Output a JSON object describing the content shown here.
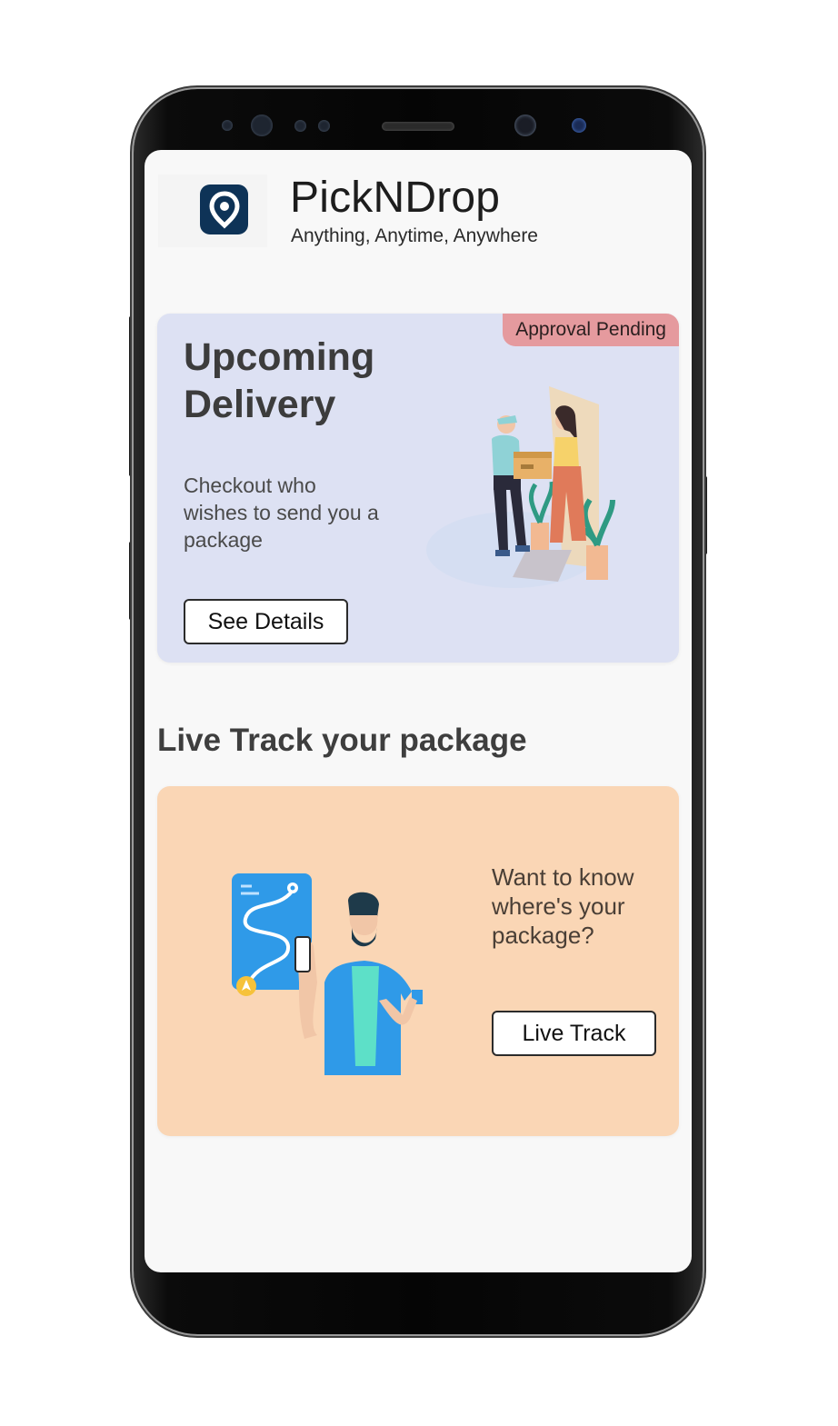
{
  "app": {
    "title": "PickNDrop",
    "tagline": "Anything, Anytime, Anywhere",
    "logo_icon": "location-pin-icon",
    "brand_color": "#0e3357"
  },
  "upcoming": {
    "badge": "Approval Pending",
    "heading": "Upcoming Delivery",
    "description": "Checkout who wishes to send  you a package",
    "button_label": "See Details",
    "illustration": "delivery-handoff-illustration",
    "background": "#dde1f3",
    "badge_color": "#e59a9e"
  },
  "live_track": {
    "section_title": "Live Track your package",
    "description": "Want to know where's your package?",
    "button_label": "Live Track",
    "illustration": "man-with-phone-map-illustration",
    "background": "#fad6b5"
  }
}
